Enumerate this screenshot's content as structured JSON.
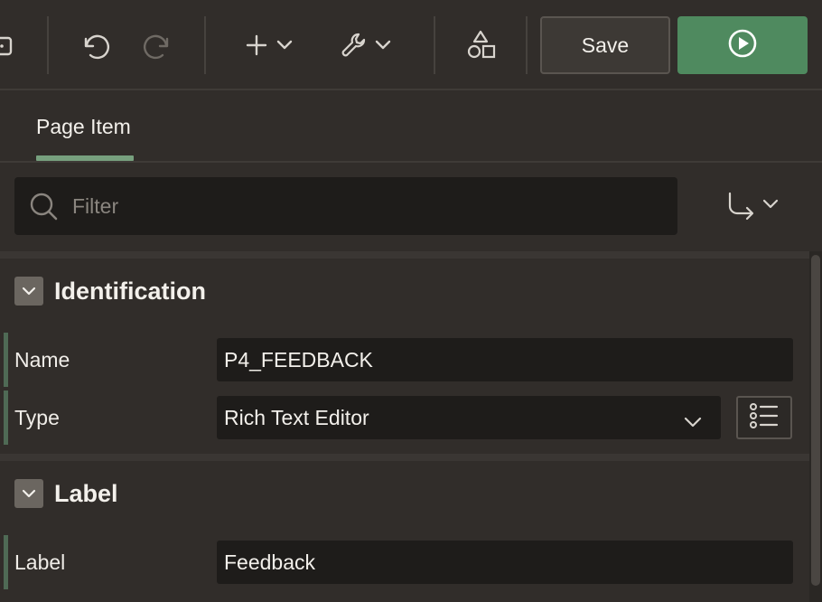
{
  "toolbar": {
    "save_label": "Save",
    "run_color": "#4f8a5f",
    "icons": [
      "partial-icon",
      "undo-icon",
      "redo-icon",
      "add-icon",
      "wrench-icon",
      "shapes-icon",
      "play-icon"
    ]
  },
  "tabs": [
    {
      "label": "Page Item",
      "active": true
    }
  ],
  "filter": {
    "placeholder": "Filter",
    "value": ""
  },
  "groups": {
    "identification": {
      "title": "Identification",
      "rows": [
        {
          "label": "Name",
          "value": "P4_FEEDBACK"
        },
        {
          "label": "Type",
          "value": "Rich Text Editor"
        }
      ]
    },
    "label": {
      "title": "Label",
      "rows": [
        {
          "label": "Label",
          "value": "Feedback"
        }
      ]
    }
  }
}
